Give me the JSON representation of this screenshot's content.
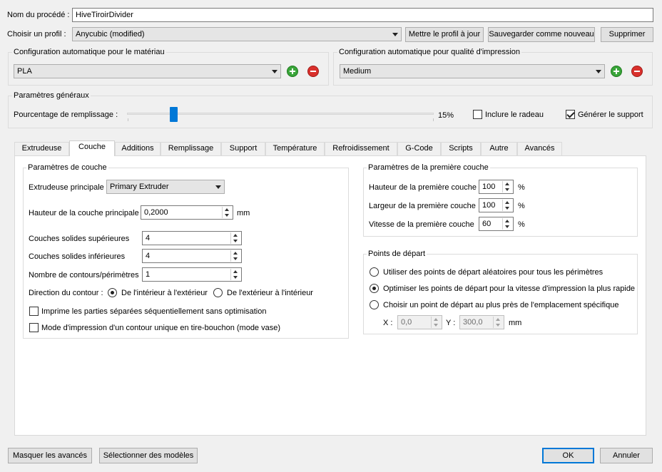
{
  "procedure": {
    "name_label": "Nom du procédé :",
    "name_value": "HiveTiroirDivider"
  },
  "profile": {
    "label": "Choisir un profil :",
    "selected": "Anycubic (modified)",
    "update_button": "Mettre le profil à jour",
    "save_new_button": "Sauvegarder comme nouveau",
    "delete_button": "Supprimer"
  },
  "material": {
    "group_title": "Configuration automatique pour le matériau",
    "selected": "PLA"
  },
  "quality": {
    "group_title": "Configuration automatique pour qualité d'impression",
    "selected": "Medium"
  },
  "general": {
    "group_title": "Paramètres généraux",
    "infill_label": "Pourcentage de remplissage :",
    "infill_percent": 15,
    "infill_value_text": "15%",
    "raft_label": "Inclure le radeau",
    "raft_checked": false,
    "support_label": "Générer le support",
    "support_checked": true
  },
  "tabs": [
    {
      "label": "Extrudeuse",
      "active": false
    },
    {
      "label": "Couche",
      "active": true
    },
    {
      "label": "Additions",
      "active": false
    },
    {
      "label": "Remplissage",
      "active": false
    },
    {
      "label": "Support",
      "active": false
    },
    {
      "label": "Température",
      "active": false
    },
    {
      "label": "Refroidissement",
      "active": false
    },
    {
      "label": "G-Code",
      "active": false
    },
    {
      "label": "Scripts",
      "active": false
    },
    {
      "label": "Autre",
      "active": false
    },
    {
      "label": "Avancés",
      "active": false
    }
  ],
  "layer": {
    "group_title": "Paramètres de couche",
    "extruder_label": "Extrudeuse principale",
    "extruder_value": "Primary Extruder",
    "height_label": "Hauteur de la couche principale",
    "height_value": "0,2000",
    "height_unit": "mm",
    "top_label": "Couches solides supérieures",
    "top_value": "4",
    "bottom_label": "Couches solides inférieures",
    "bottom_value": "4",
    "perimeters_label": "Nombre de contours/périmètres",
    "perimeters_value": "1",
    "direction_label": "Direction du contour :",
    "direction_inside_out": "De l'intérieur à l'extérieur",
    "direction_outside_in": "De l'extérieur à l'intérieur",
    "direction_selected": "inside_out",
    "sequential_label": "Imprime les parties séparées séquentiellement sans optimisation",
    "sequential_checked": false,
    "vase_label": "Mode d'impression d'un contour unique en tire-bouchon (mode vase)",
    "vase_checked": false
  },
  "first_layer": {
    "group_title": "Paramètres de la première couche",
    "height_label": "Hauteur de la première couche",
    "height_value": "100",
    "width_label": "Largeur de la première couche",
    "width_value": "100",
    "speed_label": "Vitesse de la première couche",
    "speed_value": "60",
    "unit": "%"
  },
  "start_points": {
    "group_title": "Points de départ",
    "random_label": "Utiliser des points de départ aléatoires pour tous les périmètres",
    "optimize_label": "Optimiser les points de départ pour la vitesse d'impression la plus rapide",
    "nearest_label": "Choisir un point de départ au plus près de l'emplacement spécifique",
    "selected": "optimize",
    "x_label": "X :",
    "x_value": "0,0",
    "y_label": "Y :",
    "y_value": "300,0",
    "unit": "mm"
  },
  "footer": {
    "hide_advanced": "Masquer les avancés",
    "select_models": "Sélectionner des modèles",
    "ok": "OK",
    "cancel": "Annuler"
  },
  "colors": {
    "accent": "#0078d7",
    "add": "#3aa53a",
    "remove": "#d9302c"
  }
}
